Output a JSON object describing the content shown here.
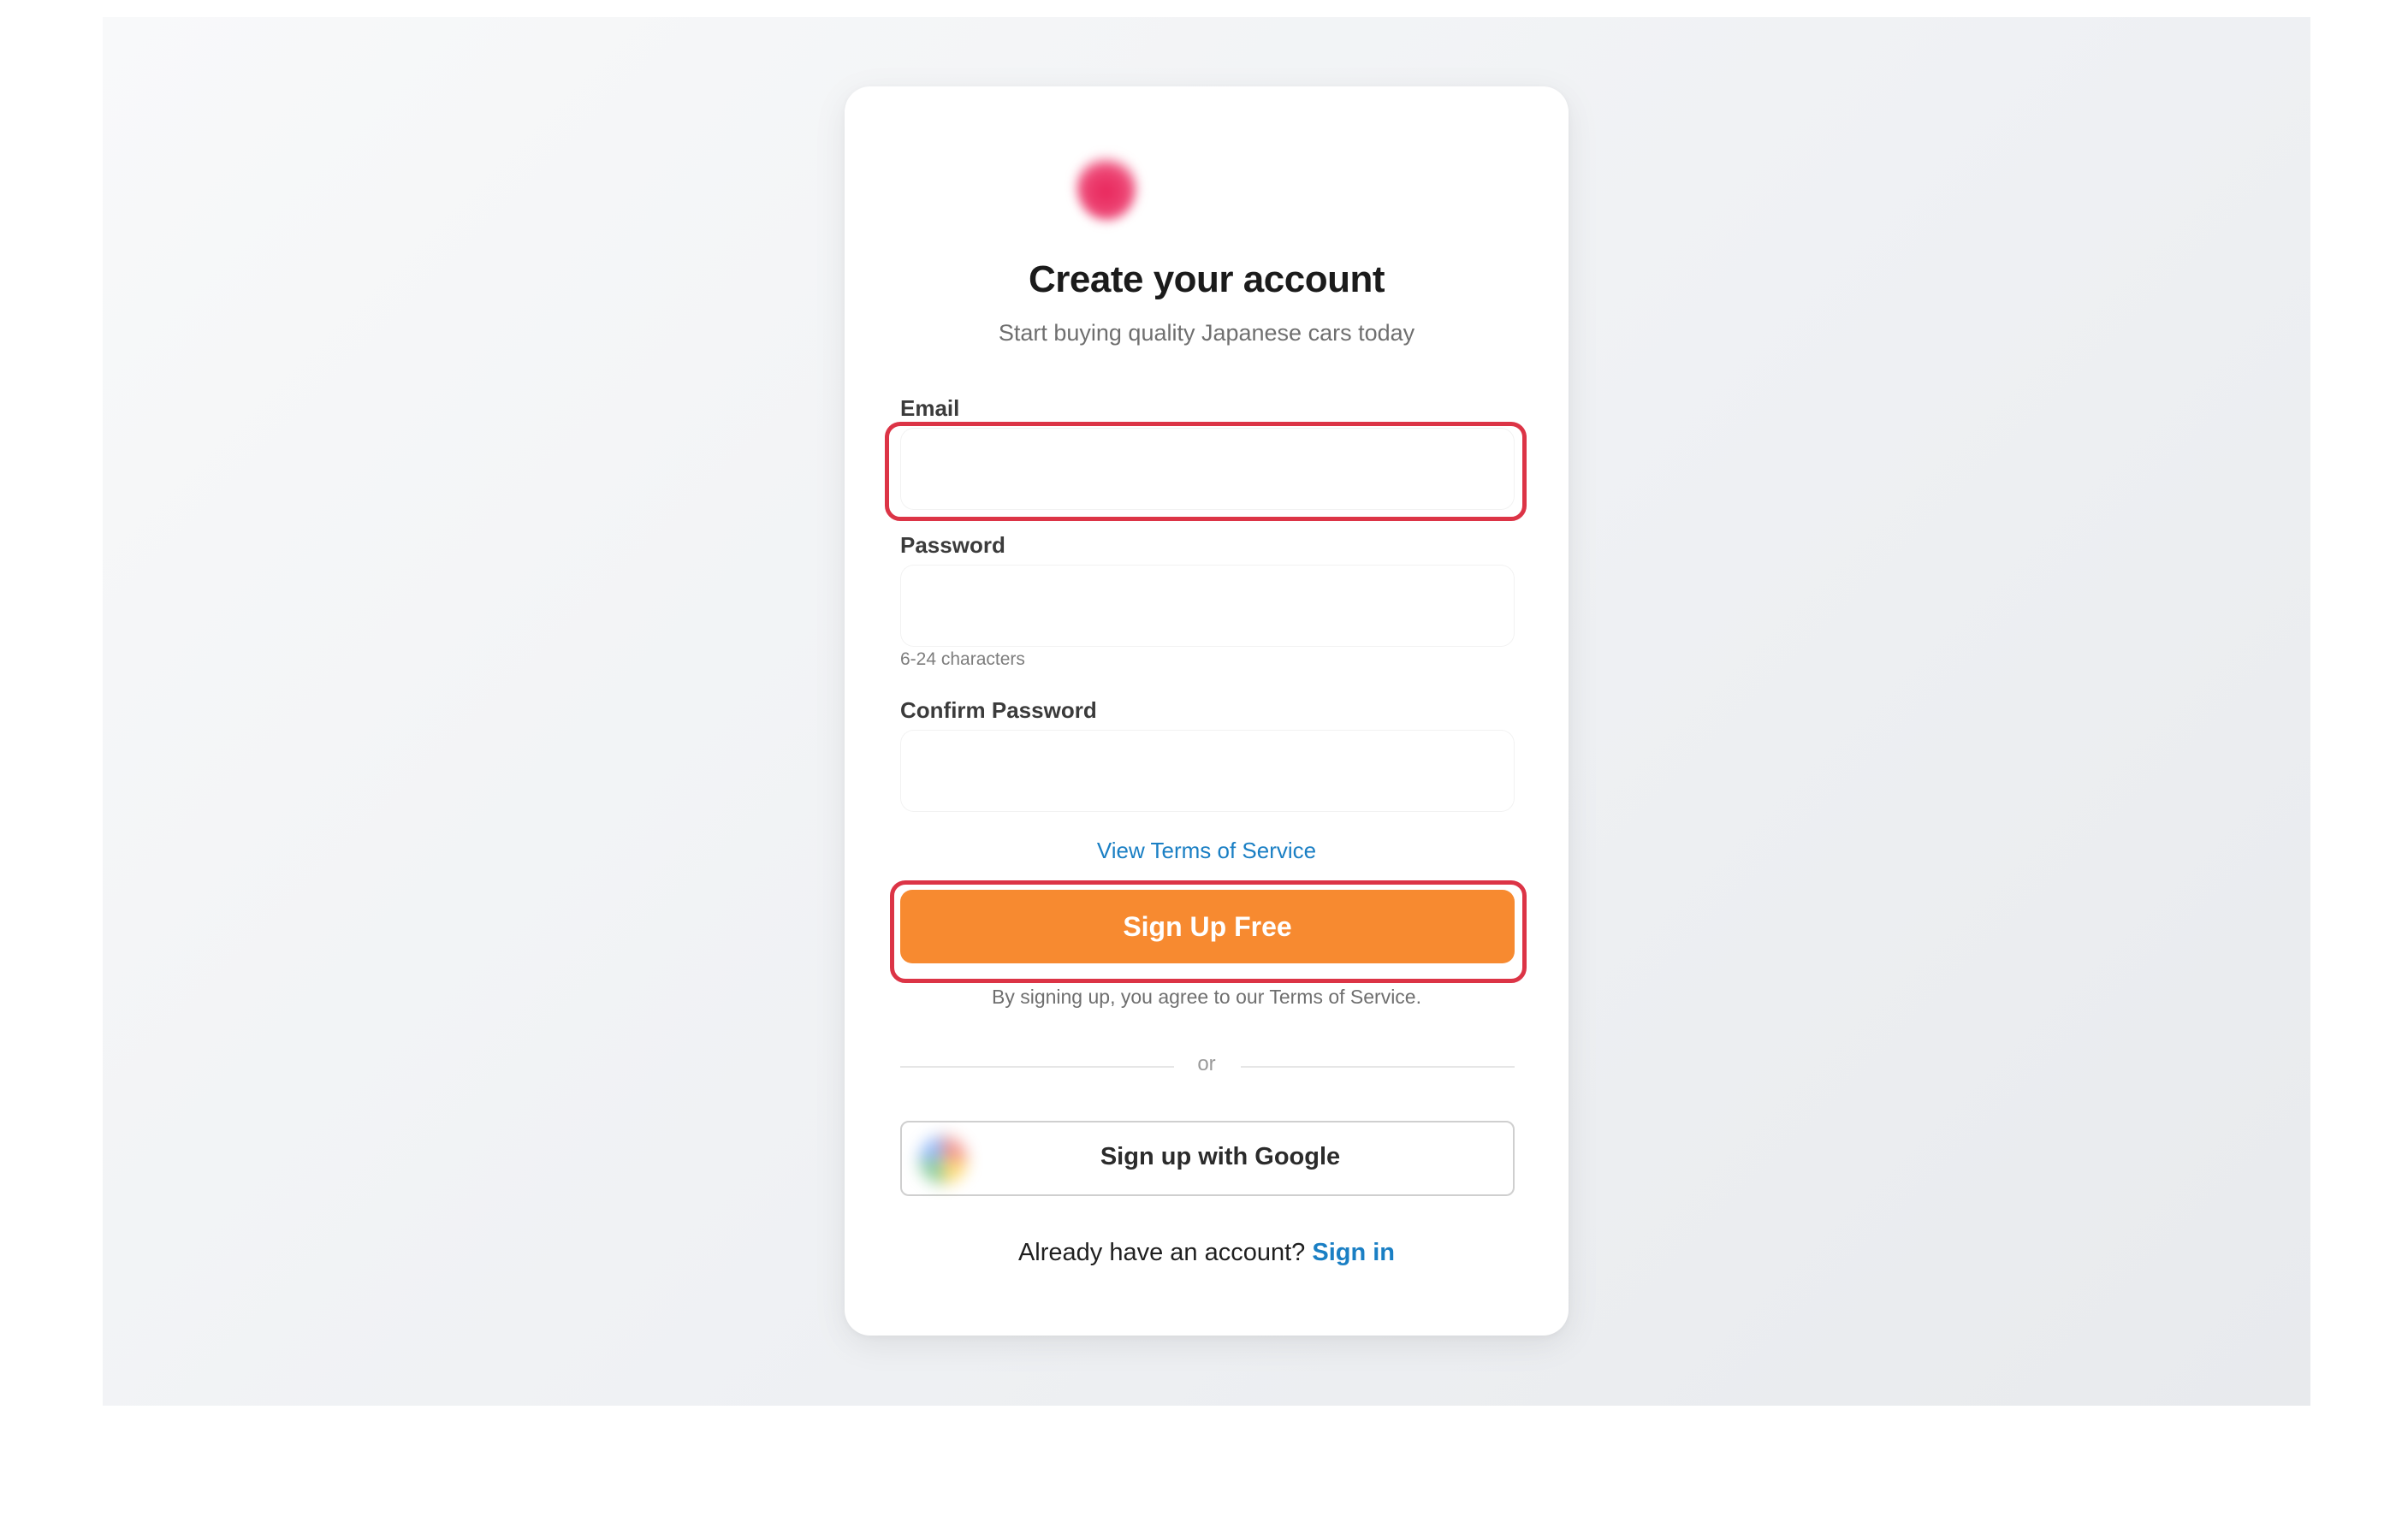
{
  "header": {
    "title": "Create your account",
    "subtitle": "Start buying quality Japanese cars today"
  },
  "form": {
    "email": {
      "label": "Email",
      "value": ""
    },
    "password": {
      "label": "Password",
      "value": "",
      "hint": "6-24 characters"
    },
    "confirm_password": {
      "label": "Confirm Password",
      "value": ""
    },
    "terms_link": "View Terms of Service",
    "submit_label": "Sign Up Free",
    "agree_text": "By signing up, you agree to our Terms of Service."
  },
  "divider": {
    "text": "or"
  },
  "google": {
    "label": "Sign up with Google"
  },
  "footer": {
    "prompt": "Already have an account?",
    "link": "Sign in"
  },
  "colors": {
    "accent": "#f78a30",
    "link": "#1a7fc4",
    "highlight": "#dc3446"
  }
}
